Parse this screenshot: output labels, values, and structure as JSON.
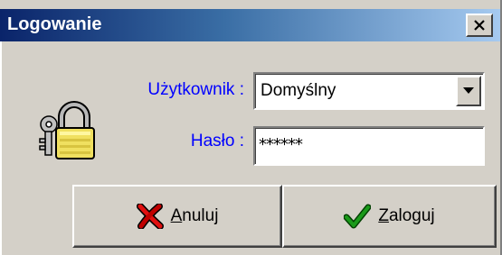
{
  "window": {
    "title": "Logowanie"
  },
  "form": {
    "user_label": "Użytkownik :",
    "user_value": "Domyślny",
    "password_label": "Hasło :",
    "password_value": "******"
  },
  "buttons": {
    "cancel": {
      "mnemonic": "A",
      "rest": "nuluj",
      "icon": "x-icon"
    },
    "login": {
      "mnemonic": "Z",
      "rest": "aloguj",
      "icon": "checkmark-icon"
    }
  },
  "icons": {
    "close": "close-icon",
    "lock": "padlock-keys-icon",
    "dropdown": "chevron-down-icon"
  },
  "colors": {
    "label": "#0000ff",
    "titlebar_start": "#0a246a",
    "titlebar_end": "#a6caf0",
    "face": "#d4d0c8"
  }
}
